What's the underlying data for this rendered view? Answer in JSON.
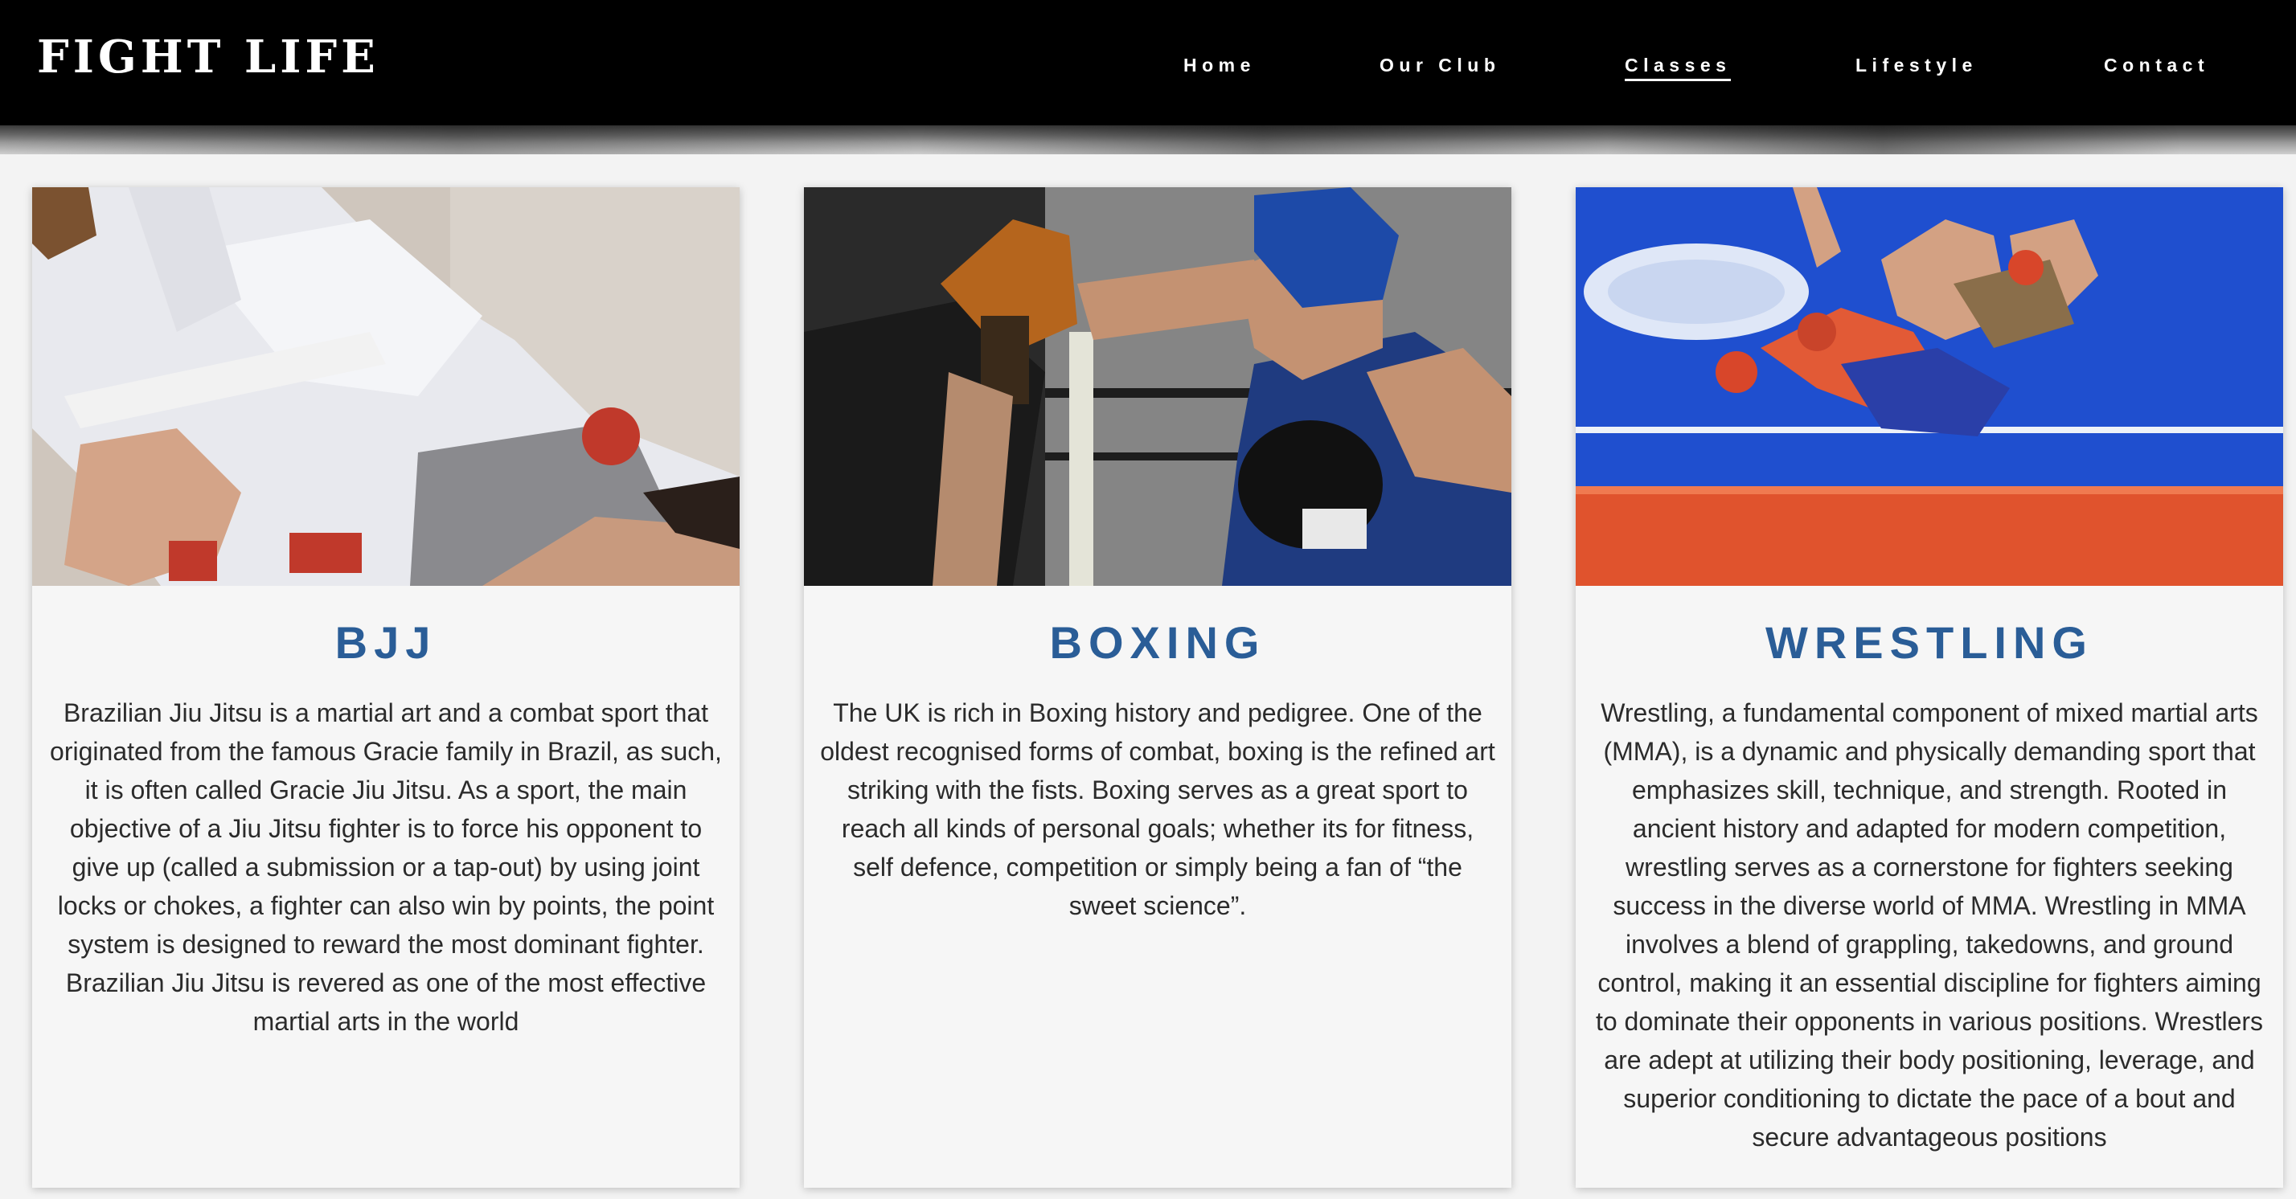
{
  "header": {
    "brand": "FIGHT LIFE",
    "nav": [
      {
        "label": "Home",
        "active": false
      },
      {
        "label": "Our Club",
        "active": false
      },
      {
        "label": "Classes",
        "active": true
      },
      {
        "label": "Lifestyle",
        "active": false
      },
      {
        "label": "Contact",
        "active": false
      }
    ]
  },
  "colors": {
    "header_bg": "#000000",
    "title_blue": "#2a5d97",
    "body_text": "#2b2b2b",
    "page_bg": "#f3f3f3"
  },
  "cards": [
    {
      "title": "BJJ",
      "image": "bjj-photo",
      "text": "Brazilian Jiu Jitsu is a martial art and a combat sport that originated from the famous Gracie family in Brazil, as such, it is often called Gracie Jiu Jitsu. As a sport, the main objective of a Jiu Jitsu fighter is to force his opponent to give up (called a submission or a tap-out) by using joint locks or chokes, a fighter can also win by points, the point system is designed to reward the most dominant fighter. Brazilian Jiu Jitsu is revered as one of the most effective martial arts in the world"
    },
    {
      "title": "BOXING",
      "image": "boxing-photo",
      "text": "The UK is rich in Boxing history and pedigree. One of the oldest recognised forms of combat, boxing is the refined art striking with the fists. Boxing serves as a great sport to reach all kinds of personal goals; whether its for fitness, self defence, competition or simply being a fan of “the sweet science”."
    },
    {
      "title": "WRESTLING",
      "image": "wrestling-photo",
      "text": "Wrestling, a fundamental component of mixed martial arts (MMA), is a dynamic and physically demanding sport that emphasizes skill, technique, and strength. Rooted in ancient history and adapted for modern competition, wrestling serves as a cornerstone for fighters seeking success in the diverse world of MMA. Wrestling in MMA involves a blend of grappling, takedowns, and ground control, making it an essential discipline for fighters aiming to dominate their opponents in various positions. Wrestlers are adept at utilizing their body positioning, leverage, and superior conditioning to dictate the pace of a bout and secure advantageous positions"
    }
  ]
}
